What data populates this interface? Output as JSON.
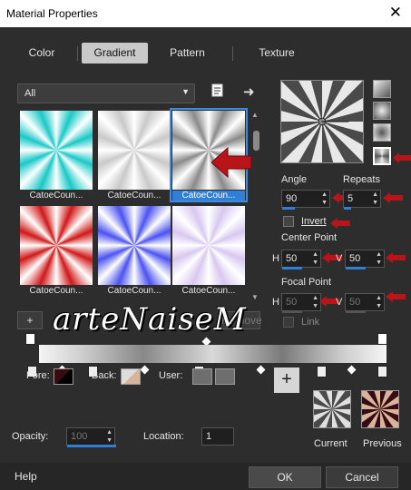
{
  "window": {
    "title": "Material Properties",
    "close_icon": "close-icon"
  },
  "tabs": [
    {
      "label": "Color",
      "active": false
    },
    {
      "label": "Gradient",
      "active": true
    },
    {
      "label": "Pattern",
      "active": false
    },
    {
      "label": "Texture",
      "active": false
    }
  ],
  "category": {
    "selected": "All"
  },
  "gradients": [
    {
      "caption": "CatoeCoun...",
      "color": "#19c8c8"
    },
    {
      "caption": "CatoeCoun...",
      "color": "#c9c9c9"
    },
    {
      "caption": "CatoeCoun...",
      "color": "#8a8a8a",
      "selected": true
    },
    {
      "caption": "CatoeCoun...",
      "color": "#d01818"
    },
    {
      "caption": "CatoeCoun...",
      "color": "#4b53f0"
    },
    {
      "caption": "CatoeCoun...",
      "color": "#d8c8f0"
    }
  ],
  "angle": {
    "label": "Angle",
    "value": "90"
  },
  "repeats": {
    "label": "Repeats",
    "value": "5"
  },
  "invert": {
    "label": "Invert",
    "checked": false
  },
  "center_point": {
    "label": "Center Point",
    "h_label": "H",
    "h": "50",
    "v_label": "V",
    "v": "50"
  },
  "focal_point": {
    "label": "Focal Point",
    "h_label": "H",
    "h": "50",
    "v_label": "V",
    "v": "50"
  },
  "link": {
    "label": "Link"
  },
  "editor": {
    "add_label": "+",
    "remove_label": "Remove"
  },
  "watermark": "arteNaiseM",
  "fore": {
    "label": "Fore:",
    "color": "#3a0a12"
  },
  "back": {
    "label": "Back:",
    "color": "#d8b59a"
  },
  "user": {
    "label": "User:"
  },
  "opacity": {
    "label": "Opacity:",
    "value": "100"
  },
  "location": {
    "label": "Location:",
    "value": "1"
  },
  "current": {
    "label": "Current"
  },
  "previous": {
    "label": "Previous"
  },
  "footer": {
    "help": "Help",
    "ok": "OK",
    "cancel": "Cancel"
  },
  "colors": {
    "accent": "#2f7fd6",
    "red_arrow": "#b8141a"
  }
}
